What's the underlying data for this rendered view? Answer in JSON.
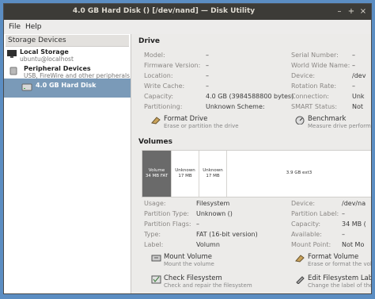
{
  "window": {
    "title": "4.0 GB Hard Disk () [/dev/nand] — Disk Utility",
    "buttons": [
      "–",
      "+",
      "×"
    ]
  },
  "menu": [
    "File",
    "Help"
  ],
  "sidebar": {
    "header": "Storage Devices",
    "items": [
      {
        "title": "Local Storage",
        "subtitle": "ubuntu@localhost"
      },
      {
        "title": "Peripheral Devices",
        "subtitle": "USB, FireWire and other peripherals"
      },
      {
        "title": "4.0 GB Hard Disk",
        "subtitle": ""
      }
    ]
  },
  "drive": {
    "section": "Drive",
    "left": [
      {
        "k": "Model:",
        "v": "–"
      },
      {
        "k": "Firmware Version:",
        "v": "–"
      },
      {
        "k": "Location:",
        "v": "–"
      },
      {
        "k": "Write Cache:",
        "v": "–"
      },
      {
        "k": "Capacity:",
        "v": "4.0 GB (3984588800 bytes)"
      },
      {
        "k": "Partitioning:",
        "v": "Unknown Scheme:"
      }
    ],
    "right": [
      {
        "k": "Serial Number:",
        "v": "–"
      },
      {
        "k": "World Wide Name:",
        "v": "–"
      },
      {
        "k": "Device:",
        "v": "/dev"
      },
      {
        "k": "Rotation Rate:",
        "v": "–"
      },
      {
        "k": "Connection:",
        "v": "Unk"
      },
      {
        "k": "SMART Status:",
        "v": "Not"
      }
    ],
    "actions": [
      {
        "label": "Format Drive",
        "desc": "Erase or partition the drive"
      },
      {
        "label": "Benchmark",
        "desc": "Measure drive perform"
      }
    ]
  },
  "volumes": {
    "section": "Volumes",
    "segments": [
      {
        "l1": "Volume",
        "l2": "34 MB FAT"
      },
      {
        "l1": "Unknown",
        "l2": "17 MB"
      },
      {
        "l1": "Unknown",
        "l2": "17 MB"
      },
      {
        "l1": "",
        "l2": "3.9 GB ext3"
      }
    ],
    "left": [
      {
        "k": "Usage:",
        "v": "Filesystem"
      },
      {
        "k": "Partition Type:",
        "v": "Unknown ()"
      },
      {
        "k": "Partition Flags:",
        "v": "–"
      },
      {
        "k": "Type:",
        "v": "FAT (16-bit version)"
      },
      {
        "k": "Label:",
        "v": "Volumn"
      }
    ],
    "right": [
      {
        "k": "Device:",
        "v": "/dev/na"
      },
      {
        "k": "Partition Label:",
        "v": "–"
      },
      {
        "k": "Capacity:",
        "v": "34 MB ("
      },
      {
        "k": "Available:",
        "v": "–"
      },
      {
        "k": "Mount Point:",
        "v": "Not Mo"
      }
    ],
    "actions": [
      {
        "label": "Mount Volume",
        "desc": "Mount the volume"
      },
      {
        "label": "Format Volume",
        "desc": "Erase or format the volu"
      },
      {
        "label": "Check Filesystem",
        "desc": "Check and repair the filesystem"
      },
      {
        "label": "Edit Filesystem Lab",
        "desc": "Change the label of the"
      }
    ]
  }
}
